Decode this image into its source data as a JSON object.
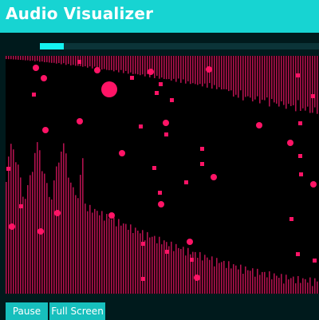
{
  "header": {
    "title": "Audio Visualizer"
  },
  "playback": {
    "progress": 0.085
  },
  "visualizer": {
    "bar_color": "#b0124e",
    "particle_color": "#ff1466"
  },
  "controls": {
    "pause_label": "Pause",
    "fullscreen_label": "Full Screen"
  },
  "colors": {
    "accent": "#17d4d2",
    "background": "#001a1c",
    "progress": "#14f2f0"
  }
}
